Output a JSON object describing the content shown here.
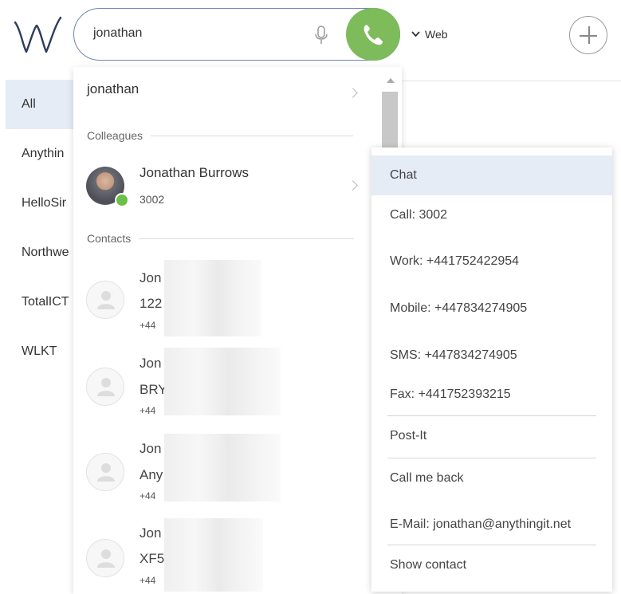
{
  "search": {
    "value": "jonathan"
  },
  "header": {
    "source_label": "Web"
  },
  "filters": [
    "All",
    "Anythin",
    "HelloSir",
    "Northwe",
    "TotalICT",
    "WLKT"
  ],
  "results": {
    "query_suggestion": "jonathan",
    "colleagues_heading": "Colleagues",
    "contacts_heading": "Contacts",
    "colleague": {
      "name": "Jonathan Burrows",
      "extension": "3002",
      "status": "online"
    },
    "contacts": [
      {
        "name": "Jon",
        "line2": "122",
        "number": "+44"
      },
      {
        "name": "Jon",
        "line2": "BRY",
        "number": "+44"
      },
      {
        "name": "Jon",
        "line2": "Any",
        "number": "+44"
      },
      {
        "name": "Jon",
        "line2": "XF5",
        "number": "+44"
      }
    ]
  },
  "menu": {
    "items": [
      "Chat",
      "Call: 3002",
      "Work: +441752422954",
      "Mobile: +447834274905",
      "SMS: +447834274905",
      "Fax: +441752393215",
      "Post-It",
      "Call me back",
      "E-Mail: jonathan@anythingit.net",
      "Show contact"
    ]
  },
  "colors": {
    "accent_call": "#7dbb5b",
    "selection": "#e6ecf6",
    "presence_online": "#6cbf4a",
    "search_border": "#6b86b5"
  }
}
